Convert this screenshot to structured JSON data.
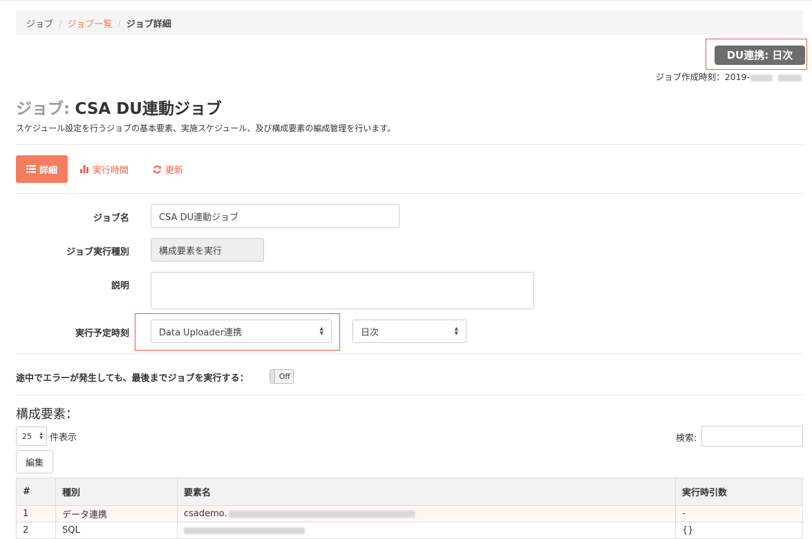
{
  "breadcrumb": {
    "home": "ジョブ",
    "list": "ジョブ一覧",
    "current": "ジョブ詳細"
  },
  "badge": {
    "label": "DU連携: 日次"
  },
  "created": {
    "label": "ジョブ作成時刻：2019-"
  },
  "title": {
    "prefix": "ジョブ:",
    "name": "CSA DU連動ジョブ"
  },
  "description": "スケジュール設定を行うジョブの基本要素、実施スケジュール、及び構成要素の編成管理を行います。",
  "tabs": [
    {
      "label": "詳細",
      "icon": "list-icon"
    },
    {
      "label": "実行時間",
      "icon": "bar-chart-icon"
    },
    {
      "label": "更新",
      "icon": "refresh-icon"
    }
  ],
  "form": {
    "job_name_label": "ジョブ名",
    "job_name_value": "CSA DU連動ジョブ",
    "job_type_label": "ジョブ実行種別",
    "job_type_value": "構成要素を実行",
    "desc_label": "説明",
    "desc_value": "",
    "schedule_label": "実行予定時刻",
    "schedule_type": "Data Uploader連携",
    "schedule_freq": "日次"
  },
  "toggle": {
    "label": "途中でエラーが発生しても、最後までジョブを実行する：",
    "value": "Off"
  },
  "components": {
    "title": "構成要素：",
    "page_size": "25",
    "page_size_suffix": "件表示",
    "search_label": "検索:",
    "edit_label": "編集",
    "columns": [
      "#",
      "種別",
      "要素名",
      "実行時引数"
    ],
    "rows": [
      {
        "no": "1",
        "type": "データ連携",
        "name": "csademo.",
        "args": "-"
      },
      {
        "no": "2",
        "type": "SQL",
        "name": "",
        "args": "{}"
      }
    ]
  },
  "colors": {
    "accent": "#f47c5f",
    "highlight_border": "#e8563e",
    "badge_bg": "#6d6d6d"
  }
}
